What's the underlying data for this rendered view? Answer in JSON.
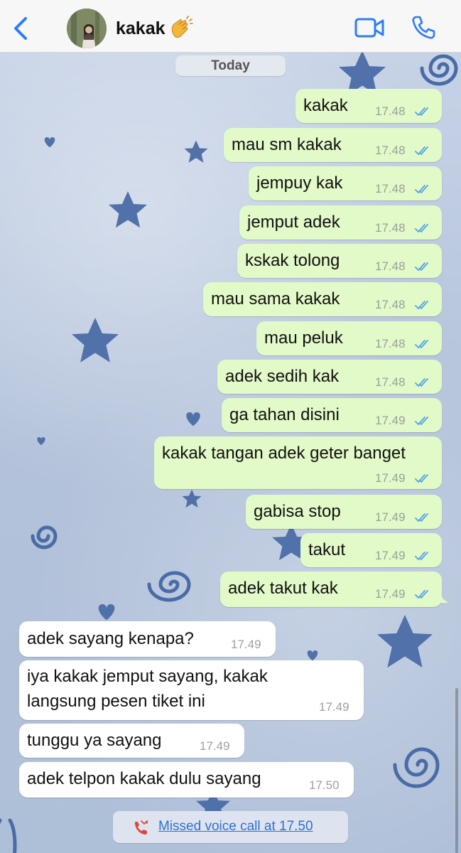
{
  "header": {
    "contact_name": "kakak",
    "contact_emoji": "👏",
    "back_icon": "chevron-left-icon",
    "video_icon": "video-camera-icon",
    "phone_icon": "phone-icon",
    "accent_color": "#2f7cf6"
  },
  "date_separator": "Today",
  "messages": [
    {
      "text": "kakak",
      "time": "17.48",
      "dir": "out"
    },
    {
      "text": "mau sm kakak",
      "time": "17.48",
      "dir": "out"
    },
    {
      "text": "jempuy kak",
      "time": "17.48",
      "dir": "out"
    },
    {
      "text": "jemput adek",
      "time": "17.48",
      "dir": "out"
    },
    {
      "text": "kskak tolong",
      "time": "17.48",
      "dir": "out"
    },
    {
      "text": "mau sama kakak",
      "time": "17.48",
      "dir": "out"
    },
    {
      "text": "mau peluk",
      "time": "17.48",
      "dir": "out"
    },
    {
      "text": "adek sedih kak",
      "time": "17.48",
      "dir": "out"
    },
    {
      "text": "ga tahan disini",
      "time": "17.49",
      "dir": "out"
    },
    {
      "text": "kakak tangan adek geter banget",
      "time": "17.49",
      "dir": "out"
    },
    {
      "text": "gabisa stop",
      "time": "17.49",
      "dir": "out"
    },
    {
      "text": "takut",
      "time": "17.49",
      "dir": "out"
    },
    {
      "text": "adek takut kak",
      "time": "17.49",
      "dir": "out"
    },
    {
      "text": "adek sayang kenapa?",
      "time": "17.49",
      "dir": "in"
    },
    {
      "text": "iya kakak jemput sayang, kakak",
      "text2": "langsung pesen tiket ini",
      "time": "17.49",
      "dir": "in"
    },
    {
      "text": "tunggu ya sayang",
      "time": "17.49",
      "dir": "in"
    },
    {
      "text": "adek telpon kakak dulu sayang",
      "time": "17.50",
      "dir": "in"
    }
  ],
  "missed_call": {
    "text": "Missed voice call at 17.50",
    "icon": "missed-call-icon"
  },
  "colors": {
    "outgoing_bubble": "#e2f9c8",
    "incoming_bubble": "#ffffff",
    "read_ticks": "#4fa3e6"
  }
}
